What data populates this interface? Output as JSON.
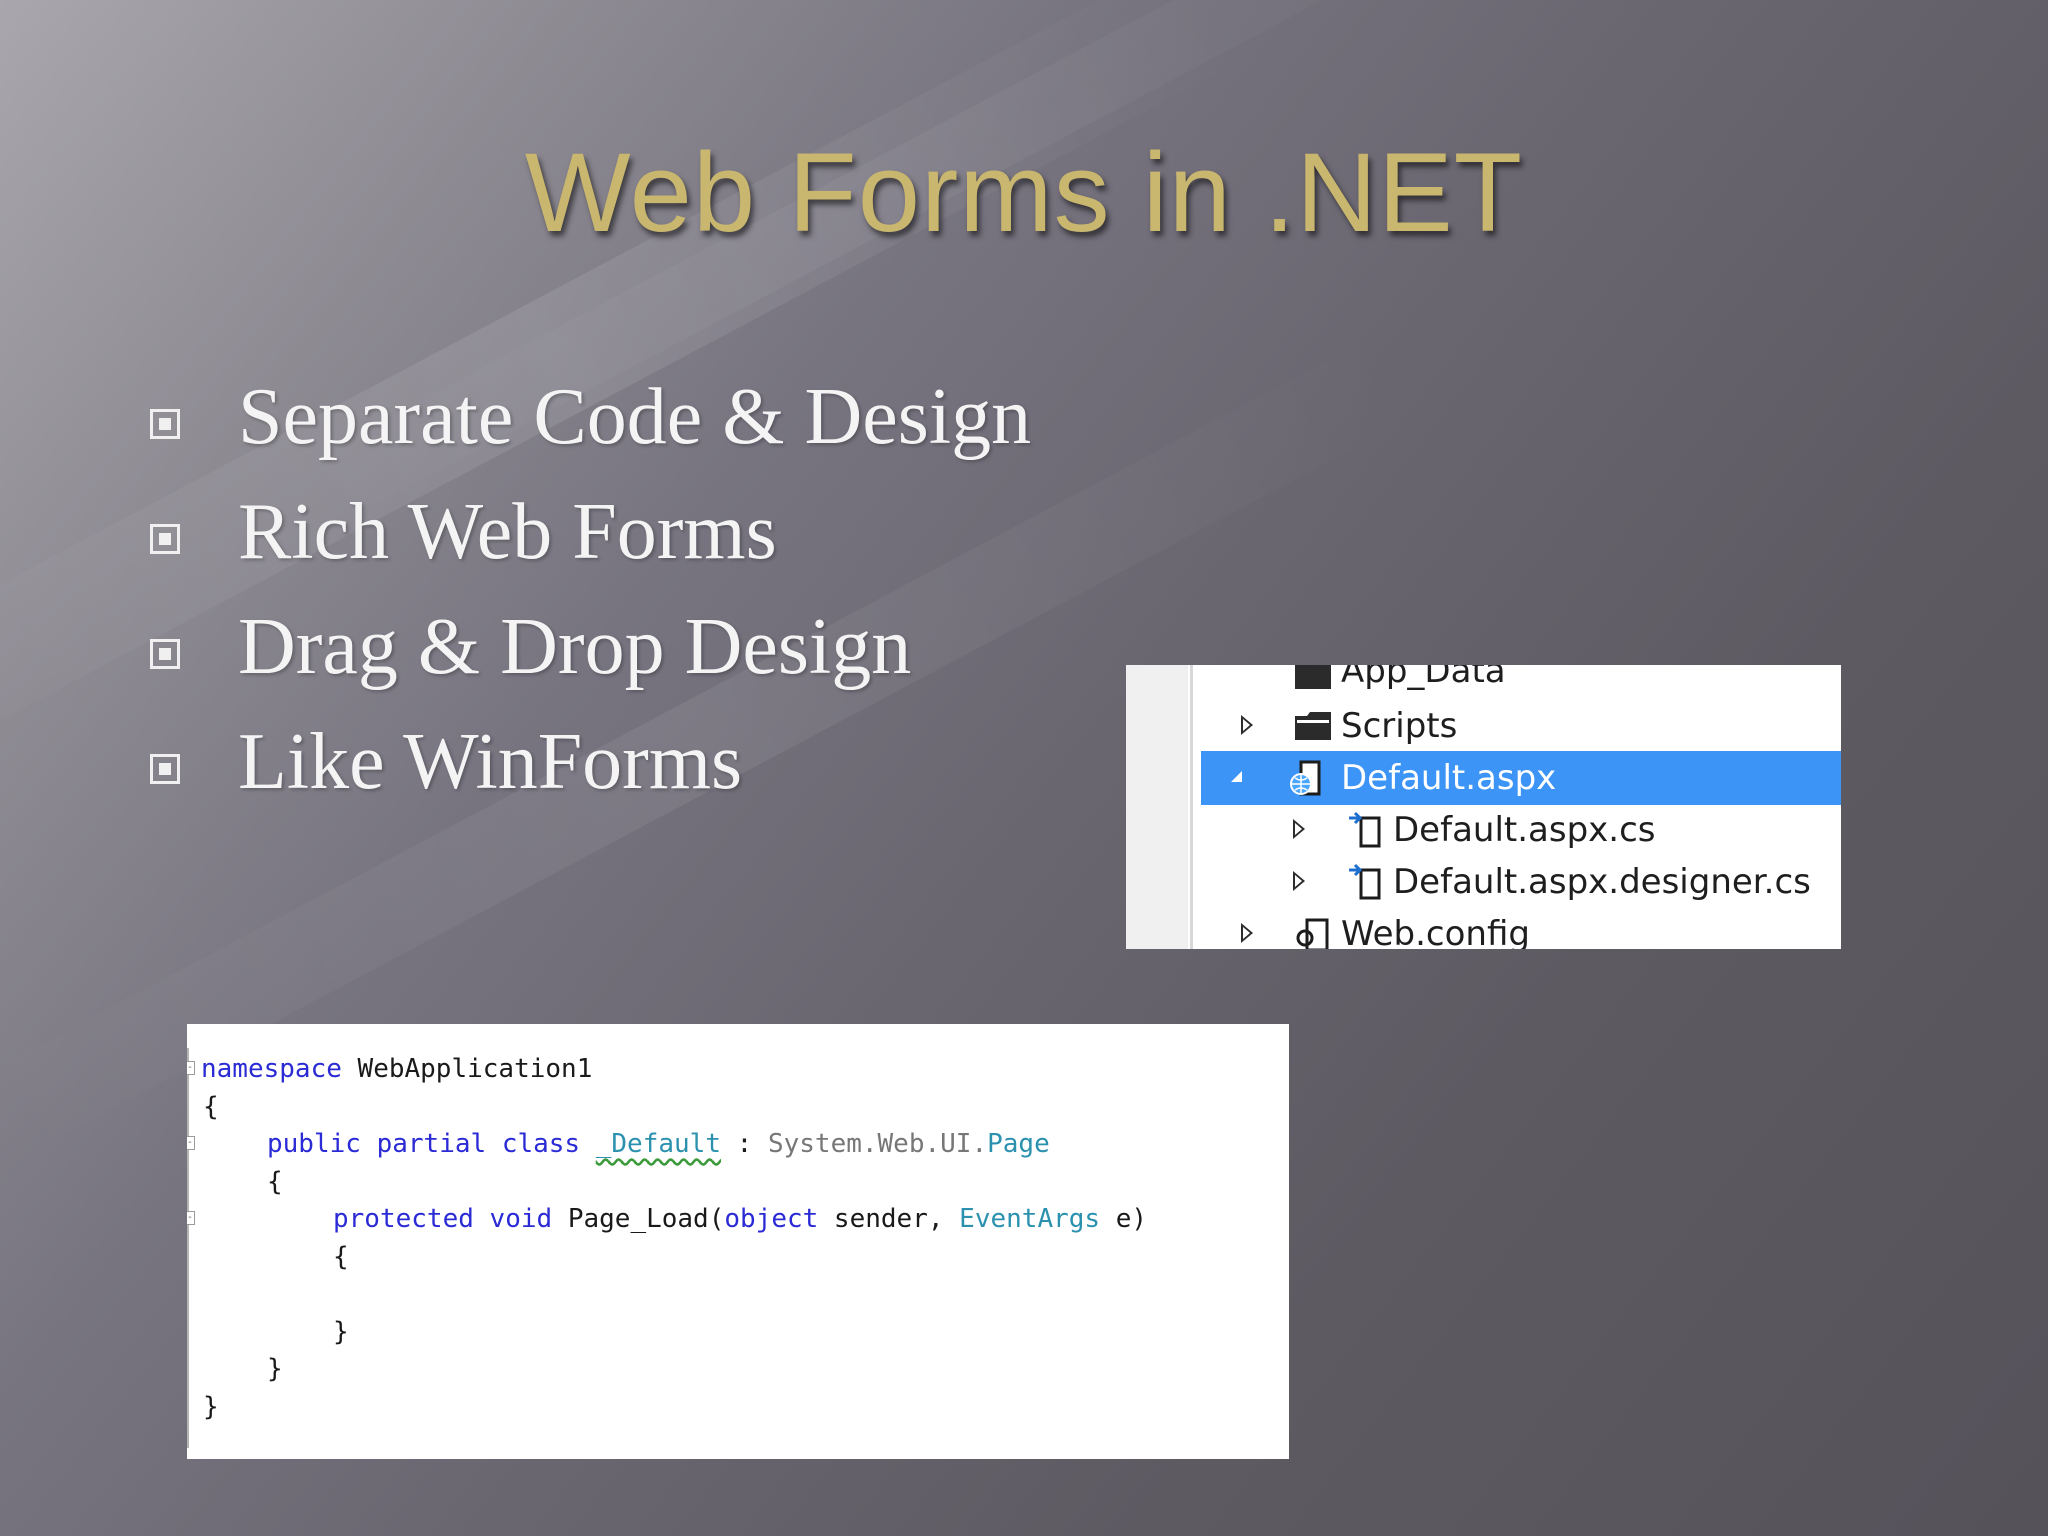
{
  "slide": {
    "title": "Web Forms in .NET",
    "bullets": [
      "Separate Code & Design",
      "Rich Web Forms",
      "Drag & Drop Design",
      "Like WinForms"
    ]
  },
  "solution_explorer": {
    "items": [
      {
        "label": "App_Data",
        "icon": "folder-icon",
        "expander": "none",
        "selected": false
      },
      {
        "label": "Scripts",
        "icon": "folder-icon",
        "expander": "collapsed",
        "selected": false
      },
      {
        "label": "Default.aspx",
        "icon": "web-form-icon",
        "expander": "expanded",
        "selected": true
      },
      {
        "label": "Default.aspx.cs",
        "icon": "code-file-icon",
        "expander": "collapsed",
        "selected": false
      },
      {
        "label": "Default.aspx.designer.cs",
        "icon": "code-file-icon",
        "expander": "collapsed",
        "selected": false
      },
      {
        "label": "Web.config",
        "icon": "config-file-icon",
        "expander": "collapsed",
        "selected": false
      }
    ],
    "selection_color": "#3b94f6"
  },
  "code": {
    "line1": {
      "kw": "namespace",
      "rest": " WebApplication1"
    },
    "line2": "{",
    "line3": {
      "kw1": "public",
      "kw2": "partial",
      "kw3": "class",
      "name": "_Default",
      "sep": " : ",
      "base_prefix": "System.Web.UI.",
      "base_type": "Page"
    },
    "line4": "{",
    "line5": {
      "kw1": "protected",
      "kw2": "void",
      "method": " Page_Load(",
      "kw3": "object",
      "param1": " sender, ",
      "type": "EventArgs",
      "param2": " e)"
    },
    "line6": "{",
    "line7": "}",
    "line8": "}",
    "line9": "}",
    "colors": {
      "keyword": "#2b2bd6",
      "type": "#2b91af"
    }
  }
}
